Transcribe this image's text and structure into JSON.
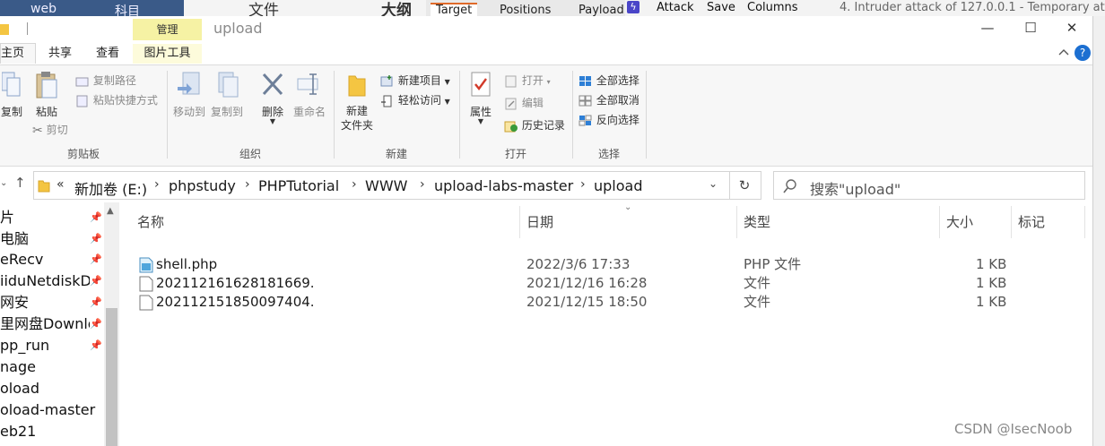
{
  "background": {
    "left_texts": [
      "web",
      "科目"
    ],
    "mid_texts": [
      "文件",
      "大纲"
    ],
    "burp_tabs": [
      "Target",
      "Positions",
      "Payload"
    ],
    "burp_menu": [
      "Attack",
      "Save",
      "Columns"
    ],
    "burp_title": "4. Intruder attack of 127.0.0.1 - Temporary attac"
  },
  "window": {
    "context_tab": "管理",
    "title": "upload",
    "controls": {
      "minimize": "—",
      "maximize": "☐",
      "close": "✕"
    }
  },
  "ribbon_tabs": {
    "home": "主页",
    "share": "共享",
    "view": "查看",
    "picture_tools": "图片工具",
    "expand_icon": "chevron-down",
    "help_icon": "?"
  },
  "ribbon": {
    "clipboard": {
      "copy": "复制",
      "paste": "粘贴",
      "copy_path": "复制路径",
      "paste_shortcut": "粘贴快捷方式",
      "cut": "剪切",
      "label": "剪贴板"
    },
    "organize": {
      "move_to": "移动到",
      "copy_to": "复制到",
      "delete": "删除",
      "rename": "重命名",
      "label": "组织"
    },
    "new": {
      "new_folder": "新建\n文件夹",
      "new_folder_l1": "新建",
      "new_folder_l2": "文件夹",
      "new_item": "新建项目",
      "easy_access": "轻松访问",
      "label": "新建"
    },
    "open": {
      "properties": "属性",
      "open": "打开",
      "edit": "编辑",
      "history": "历史记录",
      "label": "打开"
    },
    "select": {
      "select_all": "全部选择",
      "select_none": "全部取消",
      "invert": "反向选择",
      "label": "选择"
    }
  },
  "address": {
    "prefix": "«",
    "crumbs": [
      "新加卷 (E:)",
      "phpstudy",
      "PHPTutorial",
      "WWW",
      "upload-labs-master",
      "upload"
    ],
    "separator": "›",
    "search_placeholder": "搜索\"upload\""
  },
  "nav_items": [
    {
      "label": "片",
      "pinned": true
    },
    {
      "label": "电脑",
      "pinned": true
    },
    {
      "label": "eRecv",
      "pinned": true
    },
    {
      "label": "iiduNetdiskDo",
      "pinned": true
    },
    {
      "label": "网安",
      "pinned": true
    },
    {
      "label": "里网盘Downlo",
      "pinned": true
    },
    {
      "label": "pp_run",
      "pinned": true
    },
    {
      "label": "nage",
      "pinned": false
    },
    {
      "label": "oload",
      "pinned": false
    },
    {
      "label": "oload-master",
      "pinned": false
    },
    {
      "label": "eb21",
      "pinned": false
    }
  ],
  "columns": {
    "name": "名称",
    "date": "日期",
    "type": "类型",
    "size": "大小",
    "tags": "标记"
  },
  "files": [
    {
      "name": "shell.php",
      "date": "2022/3/6 17:33",
      "type": "PHP 文件",
      "size": "1 KB",
      "icon": "php-file-icon"
    },
    {
      "name": "202112161628181669.",
      "date": "2021/12/16 16:28",
      "type": "文件",
      "size": "1 KB",
      "icon": "blank-file-icon"
    },
    {
      "name": "202112151850097404.",
      "date": "2021/12/15 18:50",
      "type": "文件",
      "size": "1 KB",
      "icon": "blank-file-icon"
    }
  ],
  "watermark": "CSDN @IsecNoob"
}
